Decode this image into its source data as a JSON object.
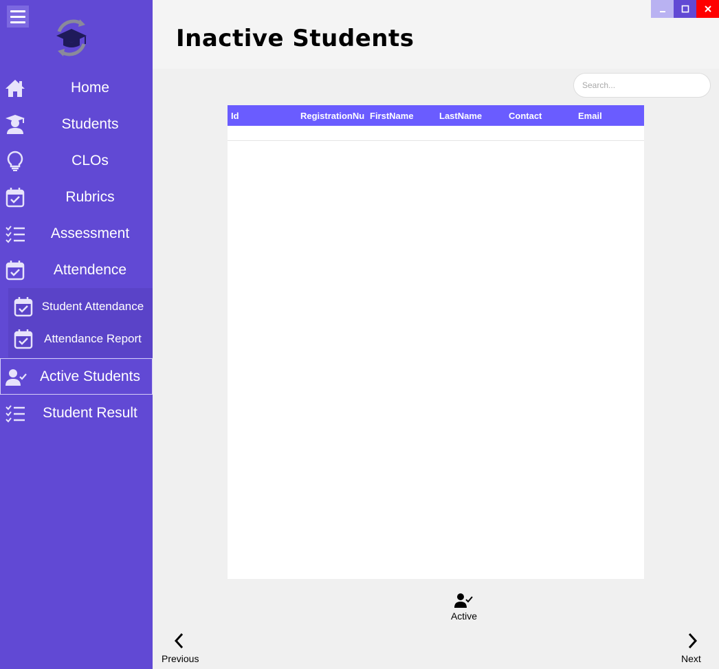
{
  "window": {
    "minimize_glyph": "_",
    "maximize_glyph": "□",
    "close_glyph": "✕"
  },
  "colors": {
    "sidebar": "#6149d4",
    "grid_header": "#6a5cff",
    "close_button": "#ff0000"
  },
  "sidebar": {
    "menu_icon": "hamburger-icon",
    "logo": "graduation-cap-logo",
    "items": [
      {
        "label": "Home",
        "icon": "home-icon"
      },
      {
        "label": "Students",
        "icon": "student-icon"
      },
      {
        "label": "CLOs",
        "icon": "lightbulb-icon"
      },
      {
        "label": "Rubrics",
        "icon": "calendar-check-icon"
      },
      {
        "label": "Assessment",
        "icon": "checklist-icon"
      },
      {
        "label": "Attendence",
        "icon": "calendar-check-icon"
      }
    ],
    "submenu": [
      {
        "label": "Student Attendance",
        "icon": "calendar-check-icon"
      },
      {
        "label": "Attendance Report",
        "icon": "calendar-check-icon"
      }
    ],
    "bottom_items": [
      {
        "label": "Active Students",
        "icon": "user-check-icon",
        "selected": true
      },
      {
        "label": "Student Result",
        "icon": "checklist-icon"
      }
    ]
  },
  "header": {
    "title": "Inactive Students"
  },
  "search": {
    "placeholder": "Search...",
    "value": ""
  },
  "grid": {
    "columns": [
      "Id",
      "RegistrationNu",
      "FirstName",
      "LastName",
      "Contact",
      "Email"
    ],
    "rows": []
  },
  "actions": {
    "active_label": "Active",
    "previous_label": "Previous",
    "next_label": "Next"
  }
}
